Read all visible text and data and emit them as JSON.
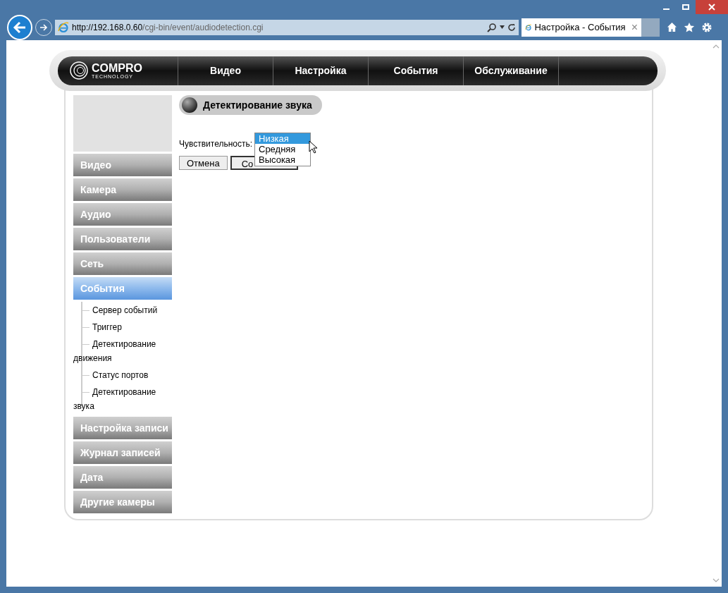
{
  "browser": {
    "url_host": "http://192.168.0.60",
    "url_path": "/cgi-bin/event/audiodetection.cgi",
    "tab_title": "Настройка - События",
    "close_tab": "×"
  },
  "logo": {
    "name": "COMPRO",
    "tagline": "TECHNOLOGY"
  },
  "nav": [
    {
      "label": "Видео",
      "selected": false
    },
    {
      "label": "Настройка",
      "selected": false
    },
    {
      "label": "События",
      "selected": false
    },
    {
      "label": "Обслуживание",
      "selected": false
    }
  ],
  "sidebar": {
    "items": [
      {
        "label": "Видео",
        "selected": false
      },
      {
        "label": "Камера",
        "selected": false
      },
      {
        "label": "Аудио",
        "selected": false
      },
      {
        "label": "Пользователи",
        "selected": false
      },
      {
        "label": "Сеть",
        "selected": false
      },
      {
        "label": "События",
        "selected": true,
        "children": [
          {
            "label": "Сервер событий"
          },
          {
            "label": "Триггер"
          },
          {
            "label": "Детектирование движения"
          },
          {
            "label": "Статус портов"
          },
          {
            "label": "Детектирование звука"
          }
        ]
      },
      {
        "label": "Настройка записи",
        "selected": false
      },
      {
        "label": "Журнал записей",
        "selected": false
      },
      {
        "label": "Дата",
        "selected": false
      },
      {
        "label": "Другие камеры",
        "selected": false
      }
    ]
  },
  "content": {
    "title": "Детектирование звука",
    "sensitivity_label": "Чувствительность:",
    "options": [
      {
        "label": "Низкая",
        "selected": true
      },
      {
        "label": "Средняя",
        "selected": false
      },
      {
        "label": "Высокая",
        "selected": false
      }
    ],
    "cancel_button": "Отмена",
    "save_button": "Со"
  }
}
